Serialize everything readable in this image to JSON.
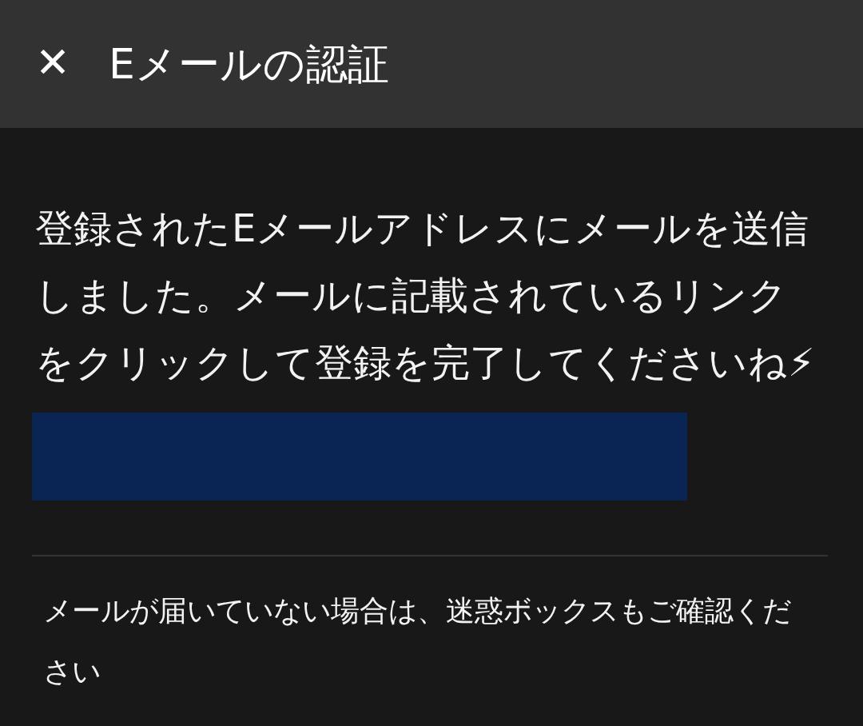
{
  "header": {
    "close": "✕",
    "title": "Eメールの認証"
  },
  "message": "登録されたEメールアドレスにメールを送信しました。メールに記載されているリンクをクリックして登録を完了してくださいね⚡",
  "note": "メールが届いていない場合は、迷惑ボックスもご確認ください"
}
